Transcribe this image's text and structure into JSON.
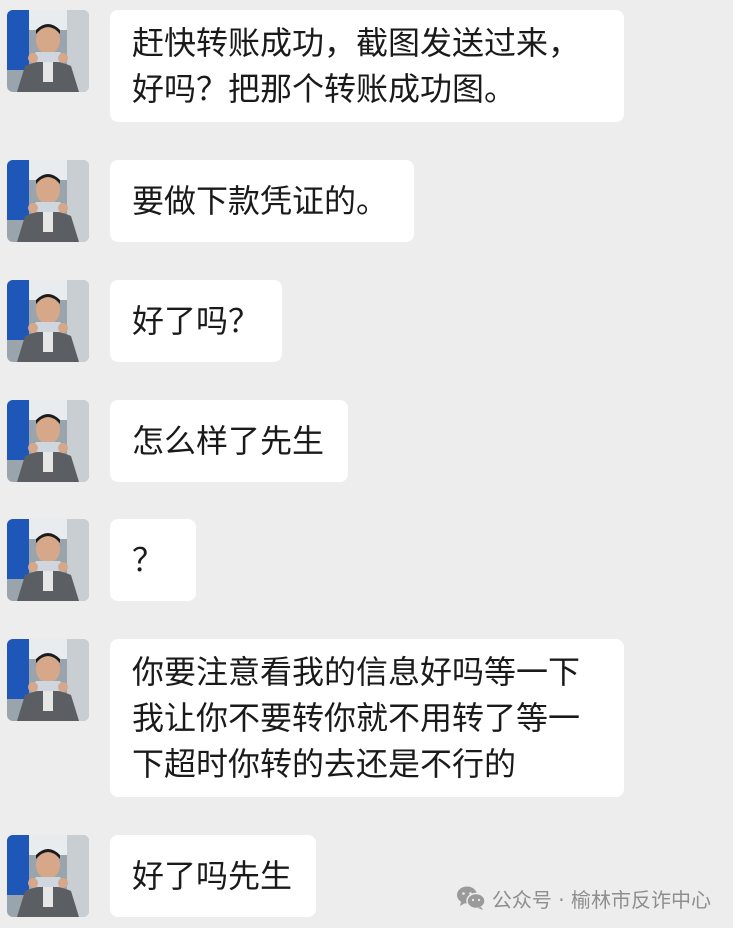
{
  "chat": {
    "messages": [
      {
        "text": "赶快转账成功，截图发送过来，好吗？把那个转账成功图。"
      },
      {
        "text": "要做下款凭证的。"
      },
      {
        "text": "好了吗？"
      },
      {
        "text": "怎么样了先生"
      },
      {
        "text": "？"
      },
      {
        "text": "你要注意看我的信息好吗等一下我让你不要转你就不用转了等一下超时你转的去还是不行的"
      },
      {
        "text": "好了吗先生"
      }
    ]
  },
  "watermark": {
    "icon": "wechat-icon",
    "text": "公众号 · 榆林市反诈中心"
  },
  "colors": {
    "background": "#ededed",
    "bubble": "#ffffff",
    "text": "#1a1a1a",
    "watermark": "#8e8e8e"
  }
}
